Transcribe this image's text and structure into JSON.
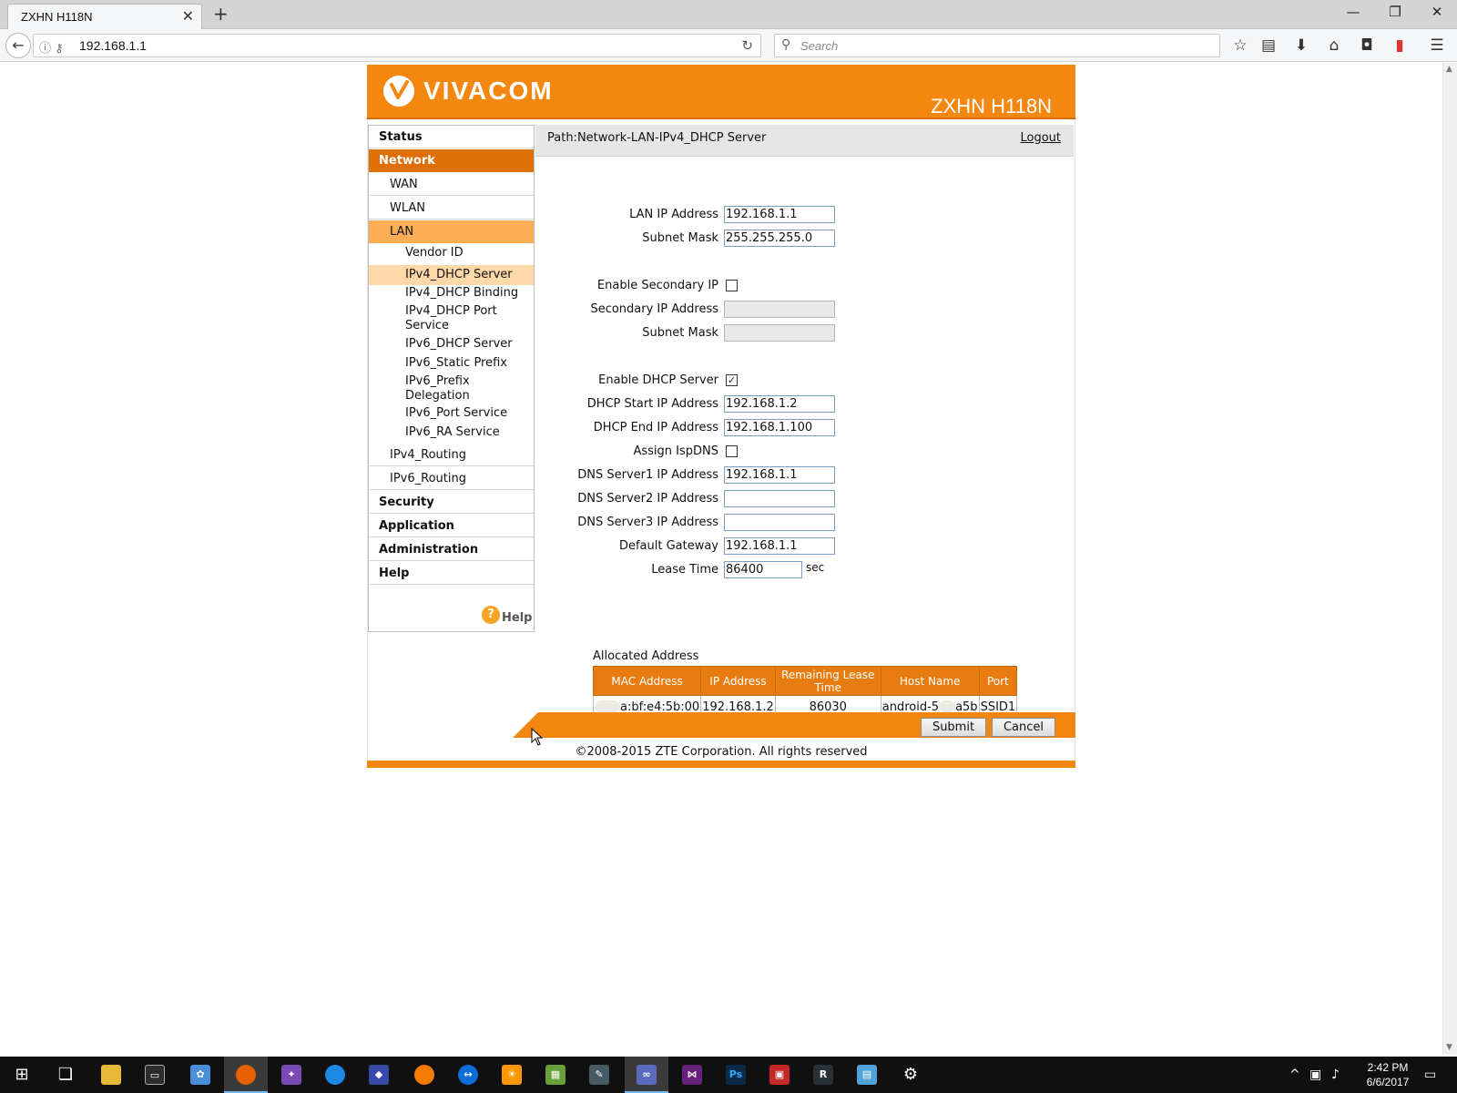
{
  "browser": {
    "tab_title": "ZXHN H118N",
    "url": "192.168.1.1",
    "search_placeholder": "Search"
  },
  "router": {
    "brand": "VIVACOM",
    "model": "ZXHN H118N",
    "path": "Path:Network-LAN-IPv4_DHCP Server",
    "logout": "Logout",
    "nav": {
      "status": "Status",
      "network": "Network",
      "wan": "WAN",
      "wlan": "WLAN",
      "lan": "LAN",
      "lan_items": [
        "Vendor ID",
        "IPv4_DHCP Server",
        "IPv4_DHCP Binding",
        "IPv4_DHCP Port Service",
        "IPv6_DHCP Server",
        "IPv6_Static Prefix",
        "IPv6_Prefix Delegation",
        "IPv6_Port Service",
        "IPv6_RA Service"
      ],
      "ipv4_routing": "IPv4_Routing",
      "ipv6_routing": "IPv6_Routing",
      "security": "Security",
      "application": "Application",
      "administration": "Administration",
      "help": "Help",
      "help_link": "Help"
    },
    "form": {
      "lan_ip_label": "LAN IP Address",
      "lan_ip": "192.168.1.1",
      "subnet_label": "Subnet Mask",
      "subnet": "255.255.255.0",
      "enable_secondary_label": "Enable Secondary IP",
      "enable_secondary": false,
      "secondary_ip_label": "Secondary IP Address",
      "secondary_ip": "",
      "secondary_subnet_label": "Subnet Mask",
      "secondary_subnet": "",
      "enable_dhcp_label": "Enable DHCP Server",
      "enable_dhcp": true,
      "dhcp_start_label": "DHCP Start IP Address",
      "dhcp_start": "192.168.1.2",
      "dhcp_end_label": "DHCP End IP Address",
      "dhcp_end": "192.168.1.100",
      "assign_ispdns_label": "Assign IspDNS",
      "assign_ispdns": false,
      "dns1_label": "DNS Server1 IP Address",
      "dns1": "192.168.1.1",
      "dns2_label": "DNS Server2 IP Address",
      "dns2": "",
      "dns3_label": "DNS Server3 IP Address",
      "dns3": "",
      "gateway_label": "Default Gateway",
      "gateway": "192.168.1.1",
      "lease_label": "Lease Time",
      "lease": "86400",
      "lease_unit": "sec"
    },
    "allocated": {
      "title": "Allocated Address",
      "headers": [
        "MAC Address",
        "IP Address",
        "Remaining Lease Time",
        "Host Name",
        "Port"
      ],
      "rows": [
        {
          "mac": "a:bf:e4:5b:00",
          "ip": "192.168.1.2",
          "remaining": "86030",
          "host_prefix": "android-5",
          "host_suffix": "a5b",
          "port": "SSID1"
        }
      ]
    },
    "buttons": {
      "submit": "Submit",
      "cancel": "Cancel"
    },
    "copyright": "©2008-2015 ZTE Corporation. All rights reserved"
  },
  "taskbar": {
    "time": "2:42 PM",
    "date": "6/6/2017"
  },
  "colors": {
    "accent": "#f4870f",
    "nav_active": "#de6e06",
    "sub_active": "#fdae55",
    "leaf_active": "#fdd8a8"
  }
}
